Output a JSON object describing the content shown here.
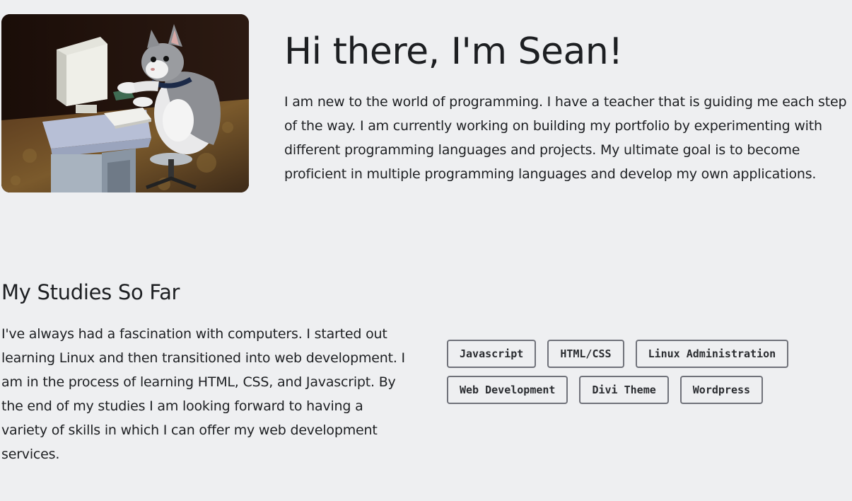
{
  "hero": {
    "image_alt": "kitten-at-computer-photo",
    "title": "Hi there, I'm Sean!",
    "intro": "I am new to the world of programming. I have a teacher that is guiding me each step of the way. I am currently working on building my portfolio by experimenting with different programming languages and projects. My ultimate goal is to become proficient in multiple programming languages and develop my own applications."
  },
  "studies": {
    "heading": "My Studies So Far",
    "text": "I've always had a fascination with computers. I started out learning Linux and then transitioned into web development. I am in the process of learning HTML, CSS, and Javascript. By the end of my studies I am looking forward to having a variety of skills in which I can offer my web development services."
  },
  "skills": [
    [
      "Javascript",
      "HTML/CSS",
      "Linux Administration"
    ],
    [
      "Web Development",
      "Divi Theme",
      "Wordpress"
    ]
  ],
  "colors": {
    "background": "#eeeff1",
    "text": "#1d1f22",
    "tag_border": "#70727a"
  }
}
